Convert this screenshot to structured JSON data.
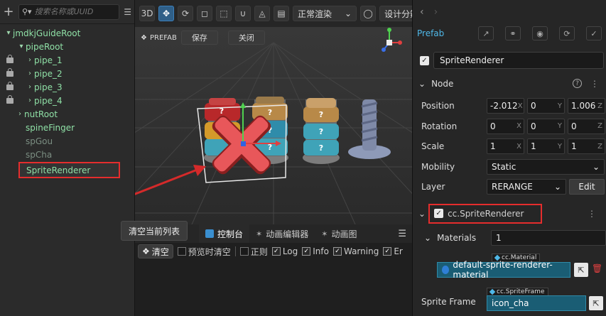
{
  "hierarchy": {
    "search_placeholder": "搜索名称或UUID",
    "items": [
      {
        "label": "jmdkjGuideRoot"
      },
      {
        "label": "pipeRoot"
      },
      {
        "label": "pipe_1"
      },
      {
        "label": "pipe_2"
      },
      {
        "label": "pipe_3"
      },
      {
        "label": "pipe_4"
      },
      {
        "label": "nutRoot"
      },
      {
        "label": "spineFinger"
      },
      {
        "label": "spGou"
      },
      {
        "label": "spCha"
      },
      {
        "label": "SpriteRenderer"
      }
    ]
  },
  "scene": {
    "toolbar": {
      "mode_3d": "3D",
      "render_mode": "正常渲染",
      "design_res": "设计分辨"
    },
    "prefab_label": "PREFAB",
    "save_label": "保存",
    "close_label": "关闭",
    "nut_marks": [
      "?",
      "?",
      "?",
      "?",
      "?",
      "?",
      "?"
    ]
  },
  "console": {
    "tabs": {
      "console": "控制台",
      "anim_editor": "动画编辑器",
      "anim_graph": "动画图"
    },
    "tooltip": "清空当前列表",
    "clear_label": "清空",
    "preview_clear": "预览时清空",
    "regex": "正则",
    "log": "Log",
    "info": "Info",
    "warning": "Warning",
    "error": "Er"
  },
  "inspector": {
    "prefab": "Prefab",
    "node_name": "SpriteRenderer",
    "node_section": "Node",
    "position": {
      "label": "Position",
      "x": "-2.012",
      "y": "0",
      "z": "1.006"
    },
    "rotation": {
      "label": "Rotation",
      "x": "0",
      "y": "0",
      "z": "0"
    },
    "scale": {
      "label": "Scale",
      "x": "1",
      "y": "1",
      "z": "1"
    },
    "axis": {
      "x": "X",
      "y": "Y",
      "z": "Z"
    },
    "mobility": {
      "label": "Mobility",
      "value": "Static"
    },
    "layer": {
      "label": "Layer",
      "value": "RERANGE",
      "edit": "Edit"
    },
    "component": "cc.SpriteRenderer",
    "materials": {
      "label": "Materials",
      "count": "1",
      "tag": "cc.Material",
      "value": "default-sprite-renderer-material"
    },
    "sprite_frame": {
      "label": "Sprite Frame",
      "tag": "cc.SpriteFrame",
      "value": "icon_cha"
    }
  }
}
